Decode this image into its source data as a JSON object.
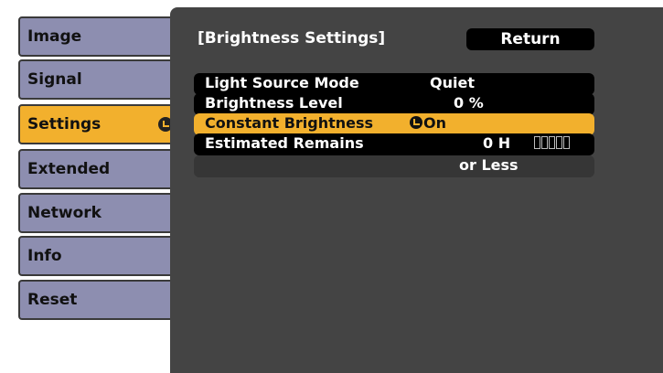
{
  "menu": {
    "items": [
      {
        "label": "Image",
        "active": false
      },
      {
        "label": "Signal",
        "active": false
      },
      {
        "label": "Settings",
        "active": true
      },
      {
        "label": "Extended",
        "active": false
      },
      {
        "label": "Network",
        "active": false
      },
      {
        "label": "Info",
        "active": false
      },
      {
        "label": "Reset",
        "active": false
      }
    ]
  },
  "panel": {
    "title": "[Brightness Settings]",
    "return_label": "Return",
    "rows": {
      "light_source_mode": {
        "label": "Light Source Mode",
        "value": "Quiet"
      },
      "brightness_level": {
        "label": "Brightness Level",
        "value": "0 %"
      },
      "constant_brightness": {
        "label": "Constant Brightness",
        "value": "On"
      },
      "estimated_remains": {
        "label": "Estimated Remains",
        "value": "0 H",
        "value_line2": "or Less",
        "gauge_segments": 5,
        "gauge_filled": 0
      }
    }
  },
  "colors": {
    "menu_item": "#8d8eb0",
    "highlight": "#f2b02d",
    "panel_bg": "#444444",
    "row_bg": "#000000"
  },
  "icons": [
    "enter-icon"
  ]
}
